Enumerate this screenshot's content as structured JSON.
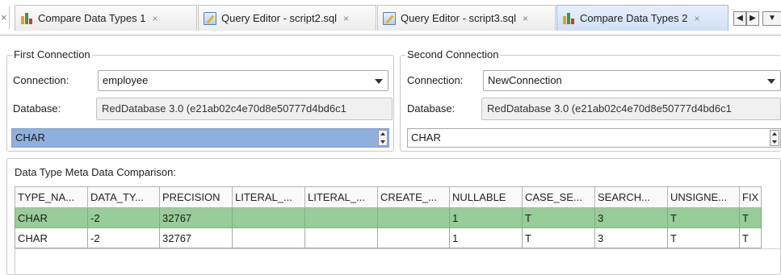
{
  "tabs": [
    {
      "label": "Compare Data Types 1",
      "icon": "compare-icon",
      "active": false
    },
    {
      "label": "Query Editor - script2.sql",
      "icon": "sql-editor-icon",
      "active": false
    },
    {
      "label": "Query Editor - script3.sql",
      "icon": "sql-editor-icon",
      "active": false
    },
    {
      "label": "Compare Data Types 2",
      "icon": "compare-icon",
      "active": true
    }
  ],
  "close_glyph": "×",
  "nav": {
    "left": "◀",
    "right": "▶",
    "menu": "▼"
  },
  "first_connection": {
    "title": "First Connection",
    "connection_label": "Connection:",
    "connection_value": "employee",
    "database_label": "Database:",
    "database_value": "RedDatabase 3.0 (e21ab02c4e70d8e50777d4bd6c1",
    "type_value": "CHAR"
  },
  "second_connection": {
    "title": "Second Connection",
    "connection_label": "Connection:",
    "connection_value": "NewConnection",
    "database_label": "Database:",
    "database_value": "RedDatabase 3.0 (e21ab02c4e70d8e50777d4bd6c1",
    "type_value": "CHAR"
  },
  "comparison": {
    "title": "Data Type Meta Data Comparison:",
    "columns": [
      "TYPE_NA...",
      "DATA_TY...",
      "PRECISION",
      "LITERAL_...",
      "LITERAL_...",
      "CREATE_...",
      "NULLABLE",
      "CASE_SE...",
      "SEARCH...",
      "UNSIGNE...",
      "FIX"
    ],
    "rows": [
      [
        "CHAR",
        "-2",
        "32767",
        "",
        "",
        "",
        "1",
        "T",
        "3",
        "T",
        "T"
      ],
      [
        "CHAR",
        "-2",
        "32767",
        "",
        "",
        "",
        "1",
        "T",
        "3",
        "T",
        "T"
      ]
    ]
  },
  "colors": {
    "diff_row": "#98cc98",
    "selection": "#8fb0df",
    "active_tab": "#cfe0f5"
  }
}
